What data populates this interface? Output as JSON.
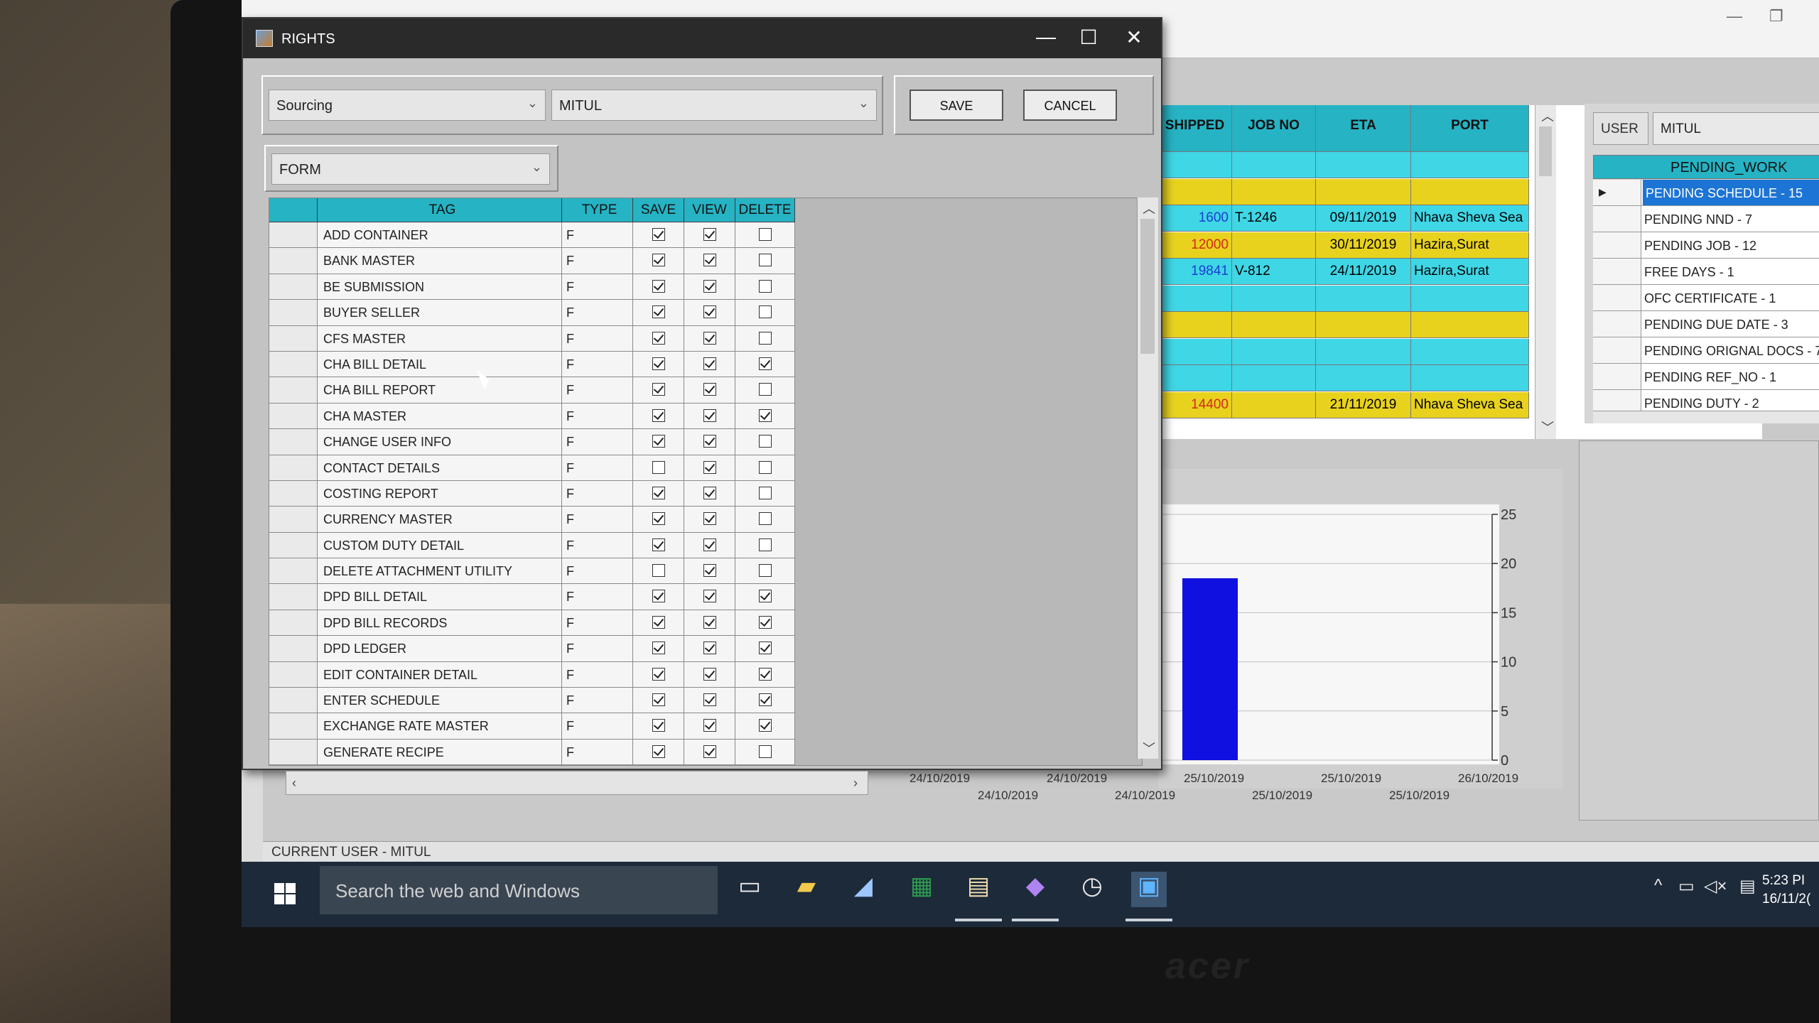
{
  "rights_dialog": {
    "title": "RIGHTS",
    "module_select": "Sourcing",
    "user_select": "MITUL",
    "type_select": "FORM",
    "save_label": "SAVE",
    "cancel_label": "CANCEL",
    "columns": [
      "TAG",
      "TYPE",
      "SAVE",
      "VIEW",
      "DELETE"
    ],
    "rows": [
      {
        "tag": "ADD CONTAINER",
        "type": "F",
        "save": true,
        "view": true,
        "delete": false
      },
      {
        "tag": "BANK MASTER",
        "type": "F",
        "save": true,
        "view": true,
        "delete": false
      },
      {
        "tag": "BE SUBMISSION",
        "type": "F",
        "save": true,
        "view": true,
        "delete": false
      },
      {
        "tag": "BUYER SELLER",
        "type": "F",
        "save": true,
        "view": true,
        "delete": false
      },
      {
        "tag": "CFS MASTER",
        "type": "F",
        "save": true,
        "view": true,
        "delete": false
      },
      {
        "tag": "CHA BILL DETAIL",
        "type": "F",
        "save": true,
        "view": true,
        "delete": true
      },
      {
        "tag": "CHA BILL REPORT",
        "type": "F",
        "save": true,
        "view": true,
        "delete": false
      },
      {
        "tag": "CHA MASTER",
        "type": "F",
        "save": true,
        "view": true,
        "delete": true
      },
      {
        "tag": "CHANGE USER INFO",
        "type": "F",
        "save": true,
        "view": true,
        "delete": false
      },
      {
        "tag": "CONTACT DETAILS",
        "type": "F",
        "save": false,
        "view": true,
        "delete": false
      },
      {
        "tag": "COSTING REPORT",
        "type": "F",
        "save": true,
        "view": true,
        "delete": false
      },
      {
        "tag": "CURRENCY MASTER",
        "type": "F",
        "save": true,
        "view": true,
        "delete": false
      },
      {
        "tag": "CUSTOM DUTY DETAIL",
        "type": "F",
        "save": true,
        "view": true,
        "delete": false
      },
      {
        "tag": "DELETE ATTACHMENT UTILITY",
        "type": "F",
        "save": false,
        "view": true,
        "delete": false
      },
      {
        "tag": "DPD BILL DETAIL",
        "type": "F",
        "save": true,
        "view": true,
        "delete": true
      },
      {
        "tag": "DPD BILL RECORDS",
        "type": "F",
        "save": true,
        "view": true,
        "delete": true
      },
      {
        "tag": "DPD LEDGER",
        "type": "F",
        "save": true,
        "view": true,
        "delete": true
      },
      {
        "tag": "EDIT CONTAINER DETAIL",
        "type": "F",
        "save": true,
        "view": true,
        "delete": true
      },
      {
        "tag": "ENTER SCHEDULE",
        "type": "F",
        "save": true,
        "view": true,
        "delete": true
      },
      {
        "tag": "EXCHANGE RATE MASTER",
        "type": "F",
        "save": true,
        "view": true,
        "delete": true
      },
      {
        "tag": "GENERATE RECIPE",
        "type": "F",
        "save": true,
        "view": true,
        "delete": false
      }
    ]
  },
  "shipment_grid": {
    "columns": [
      "SHIPPED",
      "JOB NO",
      "ETA",
      "PORT"
    ],
    "rows": [
      {
        "shipped": "",
        "job": "",
        "eta": "",
        "port": "",
        "color": "#3fd6e6"
      },
      {
        "shipped": "",
        "job": "",
        "eta": "",
        "port": "",
        "color": "#e8d21e"
      },
      {
        "shipped": "1600",
        "job": "T-1246",
        "eta": "09/11/2019",
        "port": "Nhava Sheva Sea",
        "color": "#3fd6e6",
        "num_color": "#1a3fd1"
      },
      {
        "shipped": "12000",
        "job": "",
        "eta": "30/11/2019",
        "port": "Hazira,Surat",
        "color": "#e8d21e",
        "num_color": "#d42a1a"
      },
      {
        "shipped": "19841",
        "job": "V-812",
        "eta": "24/11/2019",
        "port": "Hazira,Surat",
        "color": "#3fd6e6",
        "num_color": "#1a3fd1"
      },
      {
        "shipped": "",
        "job": "",
        "eta": "",
        "port": "",
        "color": "#3fd6e6"
      },
      {
        "shipped": "",
        "job": "",
        "eta": "",
        "port": "",
        "color": "#e8d21e"
      },
      {
        "shipped": "",
        "job": "",
        "eta": "",
        "port": "",
        "color": "#3fd6e6"
      },
      {
        "shipped": "",
        "job": "",
        "eta": "",
        "port": "",
        "color": "#3fd6e6"
      },
      {
        "shipped": "14400",
        "job": "",
        "eta": "21/11/2019",
        "port": "Nhava Sheva Sea",
        "color": "#e8d21e",
        "num_color": "#d42a1a"
      }
    ]
  },
  "user_panel": {
    "label": "USER",
    "value": "MITUL",
    "pending_header": "PENDING_WORK",
    "items": [
      "PENDING SCHEDULE - 15",
      "PENDING NND - 7",
      "PENDING JOB - 12",
      "FREE DAYS - 1",
      "OFC CERTIFICATE - 1",
      "PENDING DUE DATE - 3",
      "PENDING ORIGNAL DOCS - 7",
      "PENDING REF_NO - 1",
      "PENDING DUTY - 2"
    ]
  },
  "chart_data": {
    "type": "bar",
    "x_ticks_upper": [
      "24/10/2019",
      "24/10/2019",
      "25/10/2019",
      "25/10/2019",
      "26/10/2019"
    ],
    "x_ticks_lower": [
      "24/10/2019",
      "24/10/2019",
      "25/10/2019",
      "25/10/2019"
    ],
    "y_ticks": [
      0,
      5,
      10,
      15,
      20,
      25
    ],
    "ylim": [
      0,
      25
    ],
    "series": [
      {
        "values": [
          18.5
        ]
      }
    ],
    "bar_color": "#1010e0"
  },
  "status_bar": {
    "text": "CURRENT USER   - MITUL"
  },
  "taskbar": {
    "search_placeholder": "Search the web and Windows",
    "time": "5:23 PI",
    "date": "16/11/2("
  },
  "device": {
    "brand": "acer"
  }
}
